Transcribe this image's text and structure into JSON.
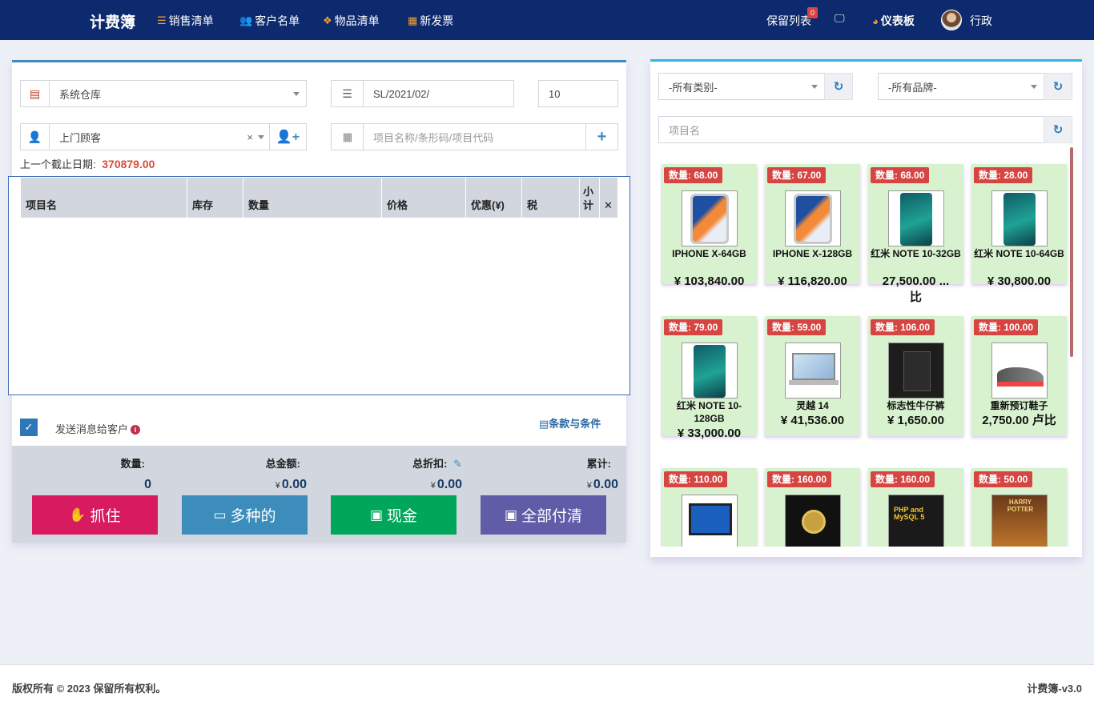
{
  "app": {
    "brand": "计费簿"
  },
  "nav": {
    "sales_list": "销售清单",
    "customer_list": "客户名单",
    "items_list": "物品清单",
    "new_invoice": "新发票",
    "hold_list": "保留列表",
    "hold_count": "0",
    "dashboard": "仪表板",
    "user": "行政"
  },
  "form": {
    "warehouse": "系统仓库",
    "invoice_no": "SL/2021/02/",
    "invoice_seq": "10",
    "customer": "上门顾客",
    "item_search_placeholder": "项目名称/条形码/项目代码",
    "last_due_label": "上一个截止日期:",
    "last_due_value": "370879.00"
  },
  "cart": {
    "headers": [
      "项目名",
      "库存",
      "数量",
      "价格",
      "优惠(¥)",
      "税",
      "小计"
    ],
    "remove_symbol": "✕"
  },
  "options": {
    "send_sms": "发送消息给客户",
    "terms": "条款与条件"
  },
  "summary": {
    "qty_label": "数量:",
    "qty_value": "0",
    "total_label": "总金额:",
    "total_value": "0.00",
    "discount_label": "总折扣:",
    "discount_value": "0.00",
    "grand_label": "累计:",
    "grand_value": "0.00",
    "currency": "¥"
  },
  "buttons": {
    "hold": "抓住",
    "multiple": "多种的",
    "cash": "现金",
    "pay_all": "全部付清"
  },
  "colors": {
    "hold": "#d81b60",
    "multiple": "#3c8dbc",
    "cash": "#00a65a",
    "pay_all": "#605ca8",
    "navbar": "#0d2a6e"
  },
  "filters": {
    "category": "-所有类别-",
    "brand": "-所有品牌-",
    "item_name_placeholder": "项目名"
  },
  "products": [
    {
      "qty": "数量: 68.00",
      "name": "IPHONE X-64GB",
      "price": "¥ 103,840.00",
      "img": "iphone"
    },
    {
      "qty": "数量: 67.00",
      "name": "IPHONE X-128GB",
      "price": "¥ 116,820.00",
      "img": "iphone"
    },
    {
      "qty": "数量: 68.00",
      "name": "红米 NOTE 10-32GB",
      "price": "27,500.00 ...",
      "price2": "比",
      "img": "redmi"
    },
    {
      "qty": "数量: 28.00",
      "name": "红米 NOTE 10-64GB",
      "price": "¥ 30,800.00",
      "img": "redmi"
    },
    {
      "qty": "数量: 79.00",
      "name": "红米 NOTE 10-128GB",
      "price": "¥ 33,000.00",
      "img": "redmi"
    },
    {
      "qty": "数量: 59.00",
      "name": "灵越 14",
      "price": "¥ 41,536.00",
      "img": "laptop"
    },
    {
      "qty": "数量: 106.00",
      "name": "标志性牛仔裤",
      "price": "¥ 1,650.00",
      "img": "jeans"
    },
    {
      "qty": "数量: 100.00",
      "name": "重新预订鞋子",
      "price": "2,750.00 卢比",
      "img": "shoe"
    },
    {
      "qty": "数量: 110.00",
      "name": "",
      "price": "",
      "img": "tablet"
    },
    {
      "qty": "数量: 160.00",
      "name": "",
      "price": "",
      "img": "watch"
    },
    {
      "qty": "数量: 160.00",
      "name": "",
      "price": "",
      "img": "book"
    },
    {
      "qty": "数量: 50.00",
      "name": "",
      "price": "",
      "img": "harry"
    }
  ],
  "product_book_text": "PHP and MySQL 5",
  "product_harry_text": "HARRY POTTER",
  "footer": {
    "copyright": "版权所有 © 2023 保留所有权利。",
    "version": "计费簿-v3.0"
  }
}
